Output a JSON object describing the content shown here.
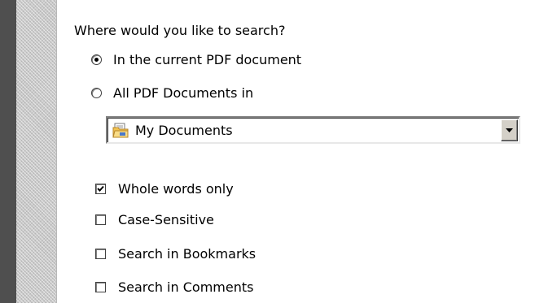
{
  "search_panel": {
    "question": "Where would you like to search?",
    "scope_options": [
      {
        "label": "In the current PDF document",
        "selected": true
      },
      {
        "label": "All PDF Documents in",
        "selected": false
      }
    ],
    "location_dropdown": {
      "value": "My Documents",
      "icon": "folder-icon"
    },
    "options": [
      {
        "label": "Whole words only",
        "checked": true
      },
      {
        "label": "Case-Sensitive",
        "checked": false
      },
      {
        "label": "Search in Bookmarks",
        "checked": false
      },
      {
        "label": "Search in Comments",
        "checked": false
      }
    ]
  },
  "colors": {
    "window_edge": "#4f4f4f",
    "control_face": "#d4d0c8"
  }
}
